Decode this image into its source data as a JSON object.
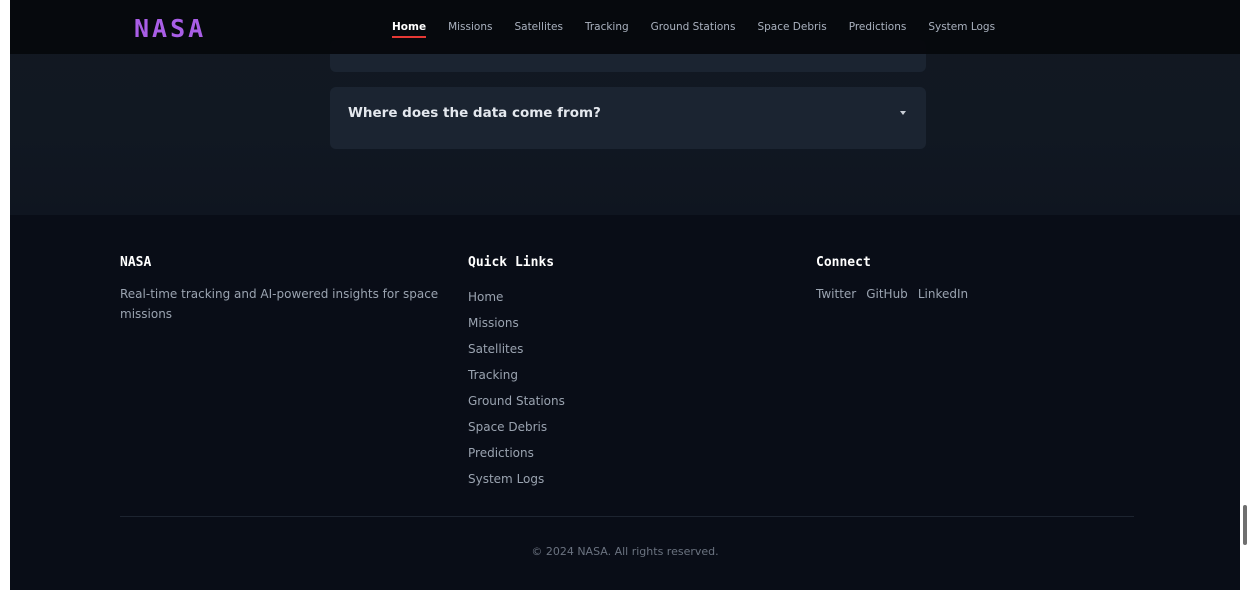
{
  "navbar": {
    "logo": "NASA",
    "links": [
      {
        "label": "Home",
        "active": true
      },
      {
        "label": "Missions"
      },
      {
        "label": "Satellites"
      },
      {
        "label": "Tracking"
      },
      {
        "label": "Ground Stations"
      },
      {
        "label": "Space Debris"
      },
      {
        "label": "Predictions"
      },
      {
        "label": "System Logs"
      }
    ],
    "active_color": "#e53935",
    "logo_color": "#a95ee6"
  },
  "faq": {
    "question": "Where does the data come from?",
    "icon": "chevron-down-icon"
  },
  "footer": {
    "brand": {
      "heading": "NASA",
      "description": "Real-time tracking and AI-powered insights for space missions"
    },
    "quick_links": {
      "heading": "Quick Links",
      "items": [
        "Home",
        "Missions",
        "Satellites",
        "Tracking",
        "Ground Stations",
        "Space Debris",
        "Predictions",
        "System Logs"
      ]
    },
    "connect": {
      "heading": "Connect",
      "items": [
        "Twitter",
        "GitHub",
        "LinkedIn"
      ]
    },
    "copyright": "© 2024 NASA. All rights reserved."
  }
}
